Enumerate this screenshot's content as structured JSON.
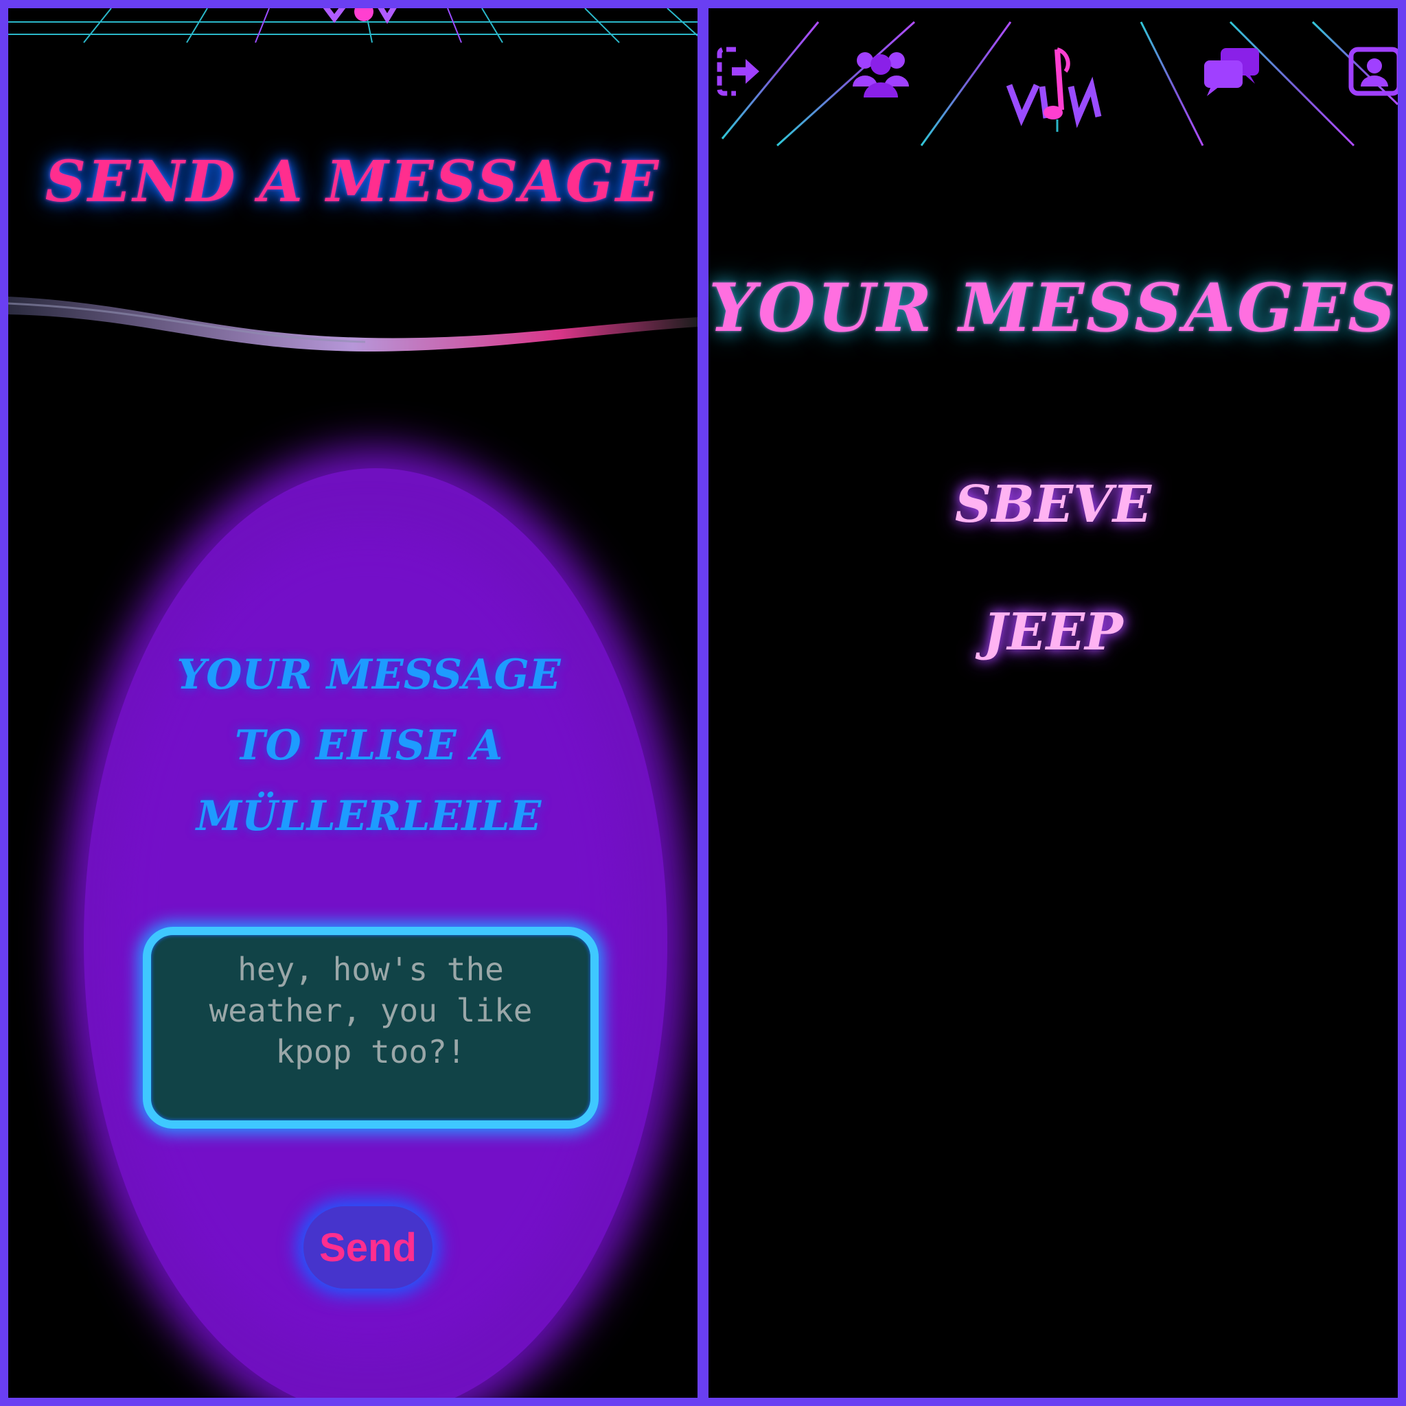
{
  "left_screen": {
    "title": "Send a Message",
    "heading_lines": [
      "Your message",
      "to Elise A",
      "Müllerleile"
    ],
    "message_value": "hey, how's the\nweather, you like\nkpop too?!",
    "send_label": "Send"
  },
  "right_screen": {
    "title": "Your Messages",
    "conversations": [
      {
        "name": "Sbeve"
      },
      {
        "name": "Jeep"
      }
    ],
    "nav_icons": [
      "logout-icon",
      "friends-icon",
      "messages-icon",
      "profile-icon"
    ],
    "logo": "music-note-logo-icon"
  },
  "colors": {
    "frame": "#6a3ff2",
    "background": "#000000",
    "pink_title": "#ff2e8e",
    "neon_blue": "#1e9bff",
    "purple_blob": "#7010c0",
    "input_bg": "#114347",
    "input_border": "#3fc8ff",
    "messages_title": "#ff6fe0",
    "conversation_name": "#ffb3f2"
  }
}
